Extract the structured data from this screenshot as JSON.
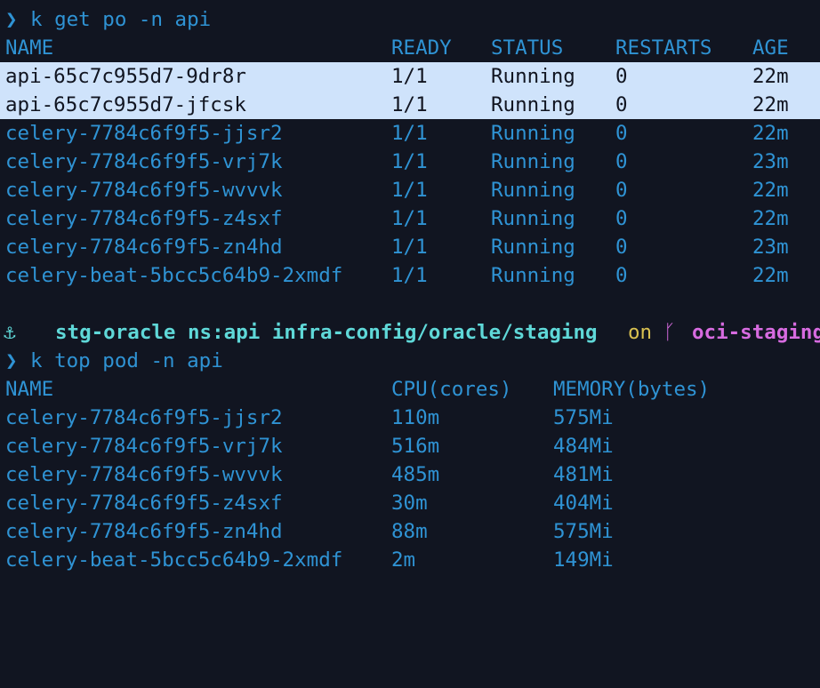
{
  "colors": {
    "background": "#111521",
    "text_blue": "#2f93d4",
    "prompt_green": "#5ee06c",
    "highlight_bg": "#cfe3fb",
    "highlight_text": "#111521",
    "status_cyan": "#5fd8d8",
    "branch_pink": "#d76be0"
  },
  "cmd1": {
    "prompt": "❯",
    "text": "k get po -n api"
  },
  "pods": {
    "headers": [
      "NAME",
      "READY",
      "STATUS",
      "RESTARTS",
      "AGE"
    ],
    "rows": [
      [
        "api-65c7c955d7-9dr8r",
        "1/1",
        "Running",
        "0",
        "22m"
      ],
      [
        "api-65c7c955d7-jfcsk",
        "1/1",
        "Running",
        "0",
        "22m"
      ],
      [
        "celery-7784c6f9f5-jjsr2",
        "1/1",
        "Running",
        "0",
        "22m"
      ],
      [
        "celery-7784c6f9f5-vrj7k",
        "1/1",
        "Running",
        "0",
        "23m"
      ],
      [
        "celery-7784c6f9f5-wvvvk",
        "1/1",
        "Running",
        "0",
        "22m"
      ],
      [
        "celery-7784c6f9f5-z4sxf",
        "1/1",
        "Running",
        "0",
        "22m"
      ],
      [
        "celery-7784c6f9f5-zn4hd",
        "1/1",
        "Running",
        "0",
        "23m"
      ],
      [
        "celery-beat-5bcc5c64b9-2xmdf",
        "1/1",
        "Running",
        "0",
        "22m"
      ]
    ]
  },
  "status_line": {
    "anchor_icon": "anchor-icon",
    "anchor": "⚓",
    "context": "stg-oracle ns:api infra-config/oracle/staging",
    "on": "on",
    "branch_icon": "git-branch-icon",
    "branch_glyph": "ᚴ",
    "branch": "oci-staging"
  },
  "cmd2": {
    "prompt": "❯",
    "text": "k top pod -n api"
  },
  "top": {
    "headers": [
      "NAME",
      "CPU(cores)",
      "MEMORY(bytes)"
    ],
    "rows": [
      [
        "celery-7784c6f9f5-jjsr2",
        "110m",
        "575Mi"
      ],
      [
        "celery-7784c6f9f5-vrj7k",
        "516m",
        "484Mi"
      ],
      [
        "celery-7784c6f9f5-wvvvk",
        "485m",
        "481Mi"
      ],
      [
        "celery-7784c6f9f5-z4sxf",
        "30m",
        "404Mi"
      ],
      [
        "celery-7784c6f9f5-zn4hd",
        "88m",
        "575Mi"
      ],
      [
        "celery-beat-5bcc5c64b9-2xmdf",
        "2m",
        "149Mi"
      ]
    ]
  }
}
